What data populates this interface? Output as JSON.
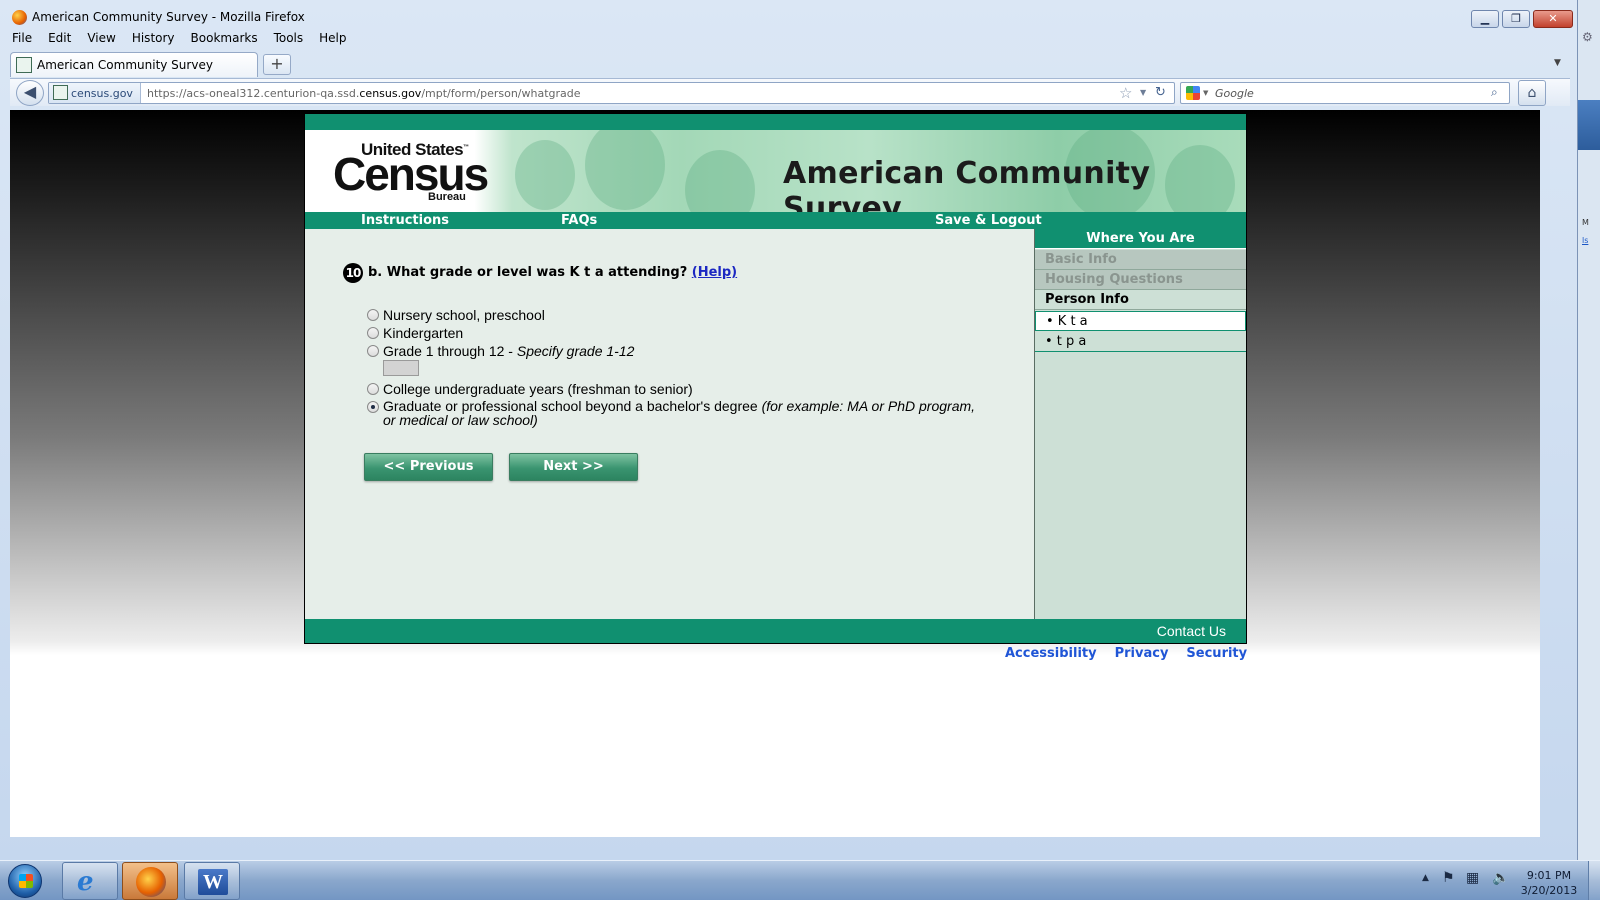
{
  "window": {
    "title": "American Community Survey - Mozilla Firefox",
    "min_icon": "▁",
    "max_icon": "❐",
    "close_icon": "✕"
  },
  "menu": [
    "File",
    "Edit",
    "View",
    "History",
    "Bookmarks",
    "Tools",
    "Help"
  ],
  "tabs": [
    {
      "label": "American Community Survey",
      "icon": "census-favicon"
    }
  ],
  "new_tab_symbol": "+",
  "navbar": {
    "back_symbol": "◀",
    "site_domain": "census.gov",
    "url_prefix": "https://acs-oneal312.centurion-qa.ssd.",
    "url_domain": "census.gov",
    "url_path": "/mpt/form/person/whatgrade",
    "search_placeholder": "Google",
    "home_symbol": "⌂"
  },
  "page": {
    "logo": {
      "line1": "United States",
      "tm": "™",
      "line2": "Census",
      "line3": "Bureau"
    },
    "title": "American Community Survey",
    "nav": {
      "instructions": "Instructions",
      "faqs": "FAQs",
      "save_logout": "Save & Logout"
    },
    "question": {
      "number": "10",
      "text": "b. What grade or level was K t a attending?",
      "help": "(Help)"
    },
    "options": [
      {
        "label": "Nursery school, preschool",
        "checked": false
      },
      {
        "label": "Kindergarten",
        "checked": false
      },
      {
        "label": "Grade 1 through 12 - ",
        "note": "Specify grade 1-12",
        "checked": false
      },
      {
        "label": "College undergraduate years (freshman to senior)",
        "checked": false
      },
      {
        "label": "Graduate or professional school beyond a bachelor's degree ",
        "note": "(for example: MA or PhD program, or medical or law school)",
        "checked": true
      }
    ],
    "grade_value": "",
    "buttons": {
      "previous": "<<   Previous",
      "next": "Next   >>"
    },
    "sidebar": {
      "header": "Where You Are",
      "items": [
        "Basic Info",
        "Housing Questions",
        "Person Info",
        "• K t a",
        "• t p a"
      ]
    },
    "footer": {
      "contact": "Contact Us",
      "links": [
        "Accessibility",
        "Privacy",
        "Security"
      ]
    }
  },
  "taskbar": {
    "time": "9:01 PM",
    "date": "3/20/2013",
    "word_letter": "W",
    "ie_letter": "e"
  },
  "colors": {
    "census_green": "#109070",
    "sidebar_bg": "#cde0d6",
    "content_bg": "#e6eee9",
    "link_blue": "#1f55d6"
  }
}
